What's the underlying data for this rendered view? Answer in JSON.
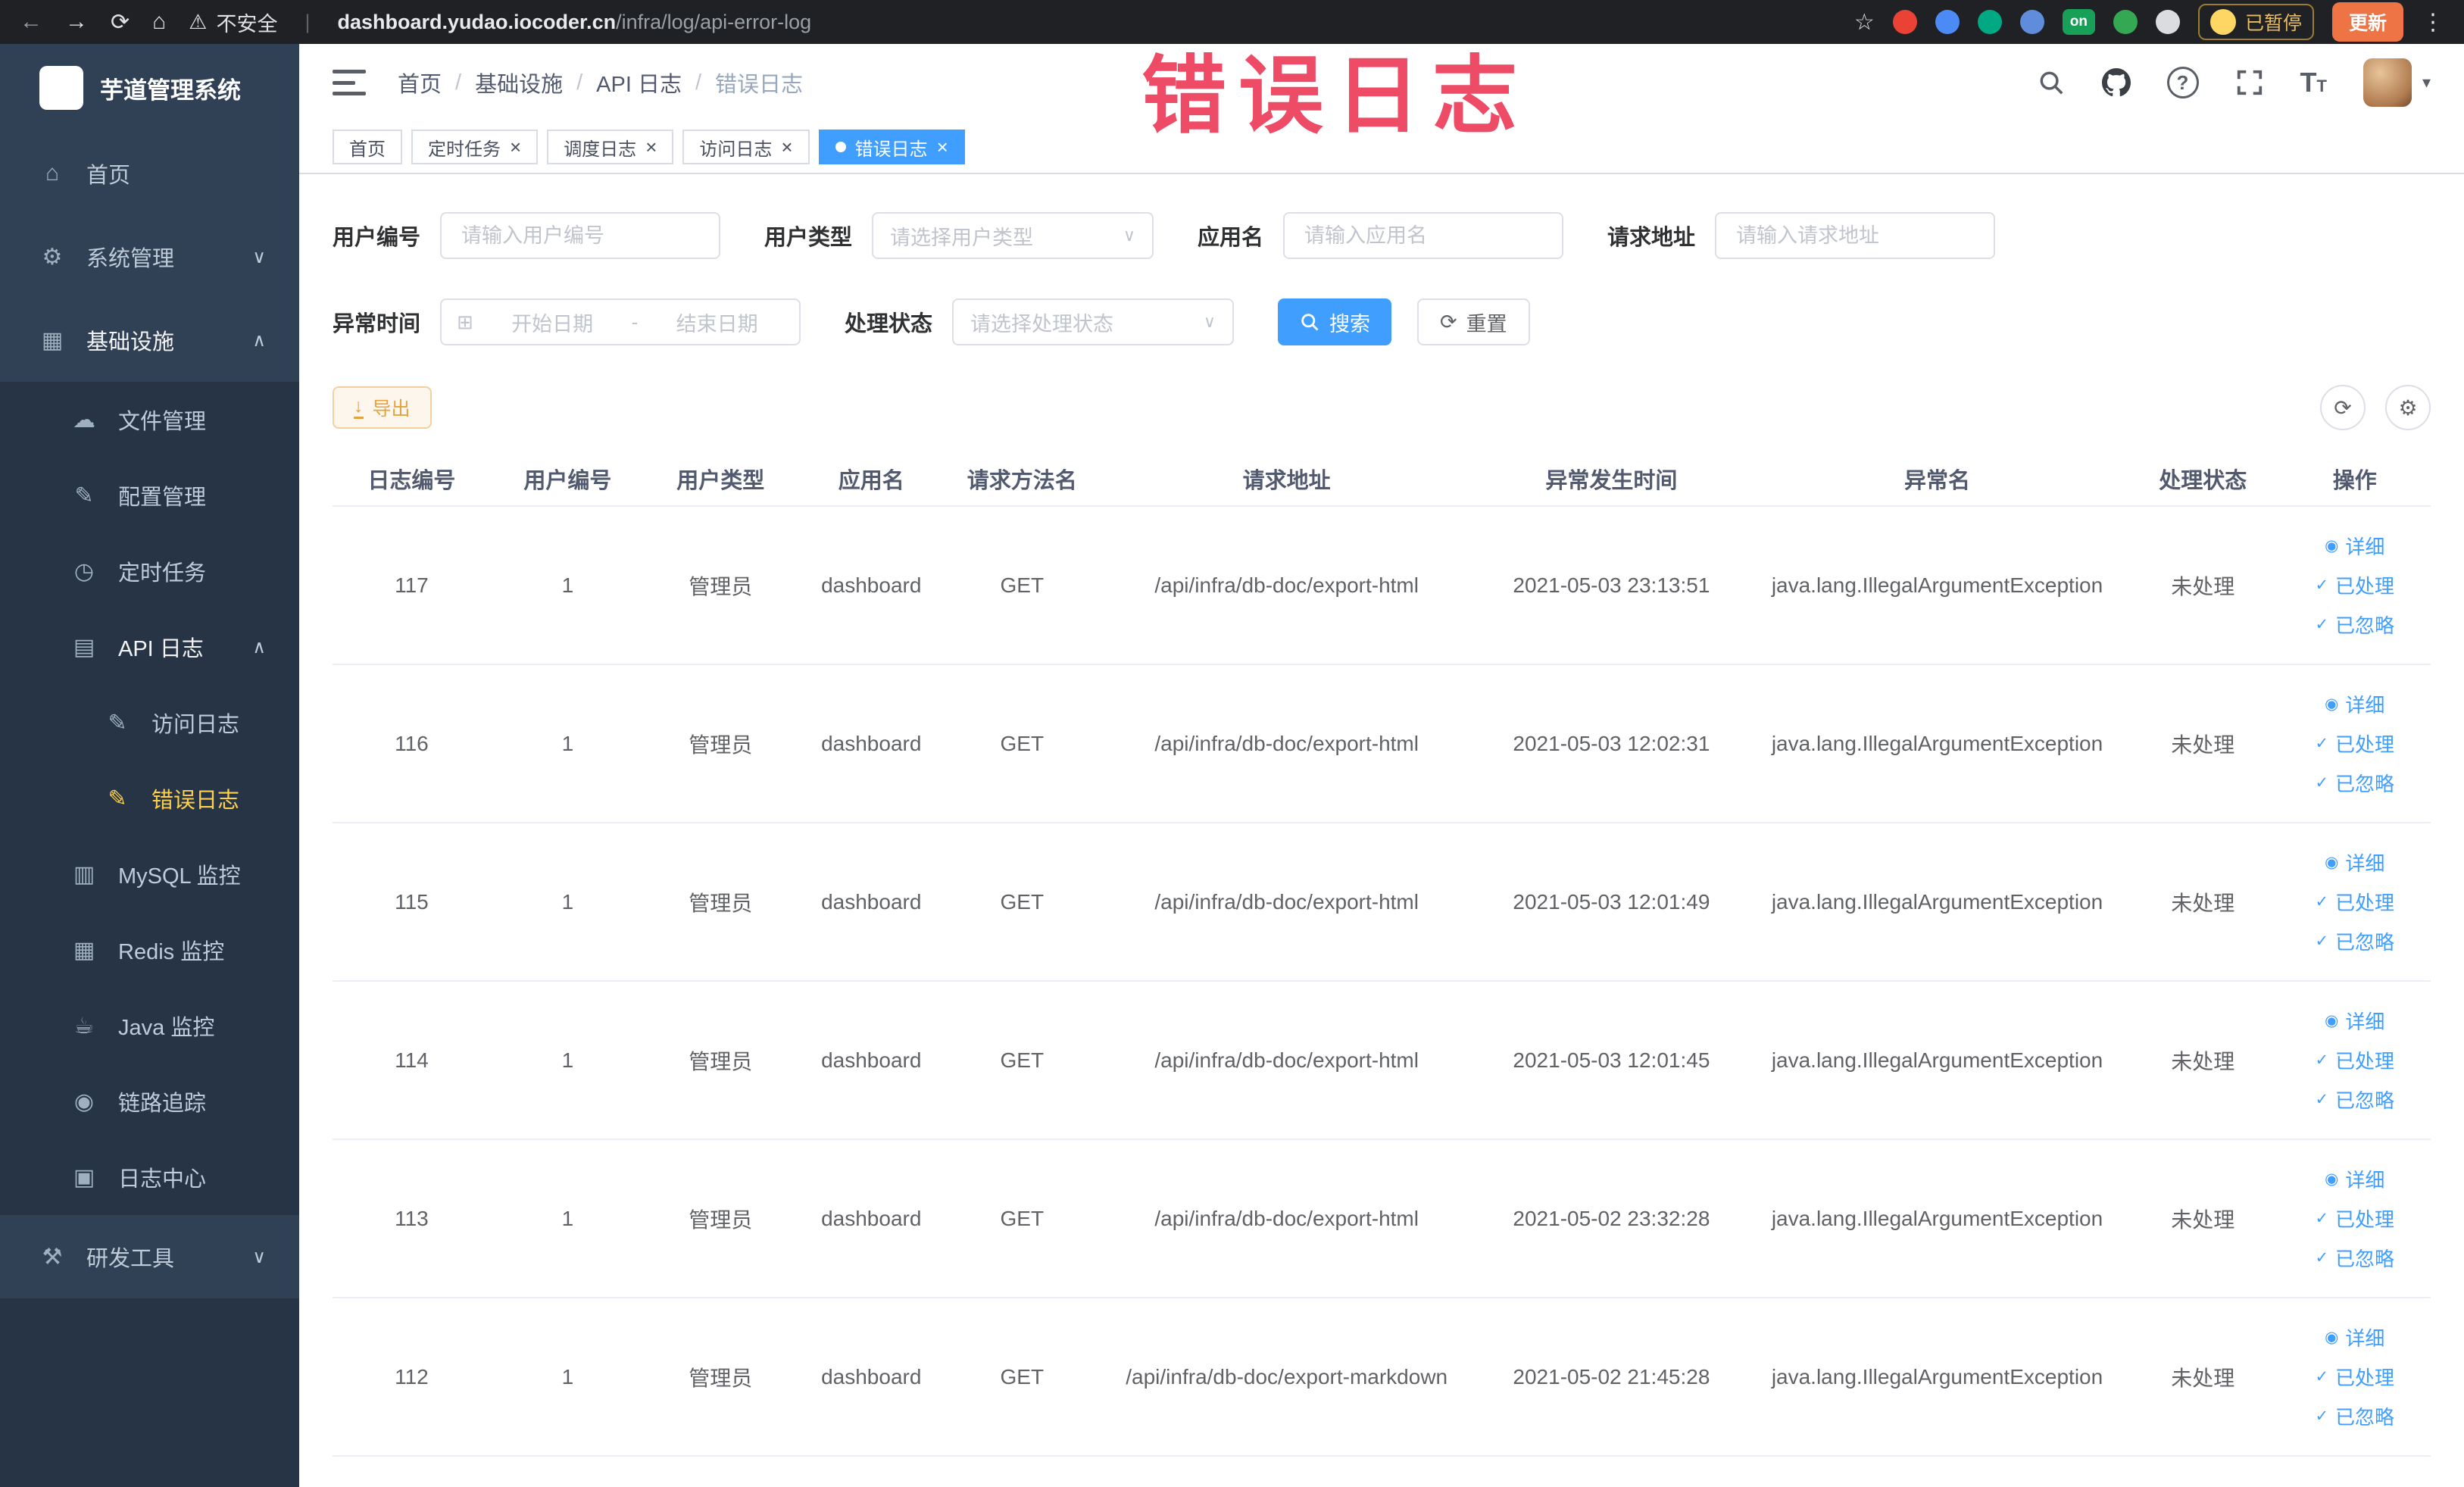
{
  "colors": {
    "accent": "#409eff",
    "sidebar_bg": "#304156",
    "submenu_bg": "#263445",
    "active_menu_text": "#ffd04b",
    "warning": "#e6a23c",
    "overlay_text": "#ee4b66",
    "toolbar_bg": "#202124",
    "update_button_bg": "#ee7445"
  },
  "icons": {
    "back": "←",
    "forward": "→",
    "reload": "⟳",
    "home": "⌂",
    "warning": "⚠",
    "star": "☆",
    "more": "⋮",
    "divider": "|",
    "close": "×",
    "chevron_down": "∨",
    "chevron_up": "∧",
    "caret": "▾",
    "question": "?",
    "letter_t": "T",
    "refresh": "⟳",
    "gear": "⚙",
    "calendar": "⊞",
    "eye": "◉",
    "check": "✓",
    "down_arrow": "↓"
  },
  "browser": {
    "security_label": "不安全",
    "url_host": "dashboard.yudao.iocoder.cn",
    "url_path": "/infra/log/api-error-log",
    "paused_badge": "已暂停",
    "update_button": "更新",
    "extensions": [
      {
        "name": "extension-red-icon",
        "color": "#ea4335"
      },
      {
        "name": "extension-blue-icon",
        "color": "#4c8bf5"
      },
      {
        "name": "extension-teal-icon",
        "color": "#00a884"
      },
      {
        "name": "extension-grid-icon",
        "color": "#5f8ddb"
      },
      {
        "name": "extension-on-badge",
        "color": "#18a058",
        "label": "on",
        "shape": "pill"
      },
      {
        "name": "extension-green-icon",
        "color": "#34a853"
      },
      {
        "name": "extension-paw-icon",
        "color": "#dadce0"
      }
    ]
  },
  "overlay": {
    "text": "错误日志"
  },
  "sidebar": {
    "logo_title": "芋道管理系统",
    "items": [
      {
        "key": "home",
        "label": "首页",
        "icon": "home-icon",
        "glyph": "⌂",
        "level": 1
      },
      {
        "key": "system-mgmt",
        "label": "系统管理",
        "icon": "gear-icon",
        "glyph": "⚙",
        "level": 1,
        "arrow": "down"
      },
      {
        "key": "infrastructure",
        "label": "基础设施",
        "icon": "infrastructure-icon",
        "glyph": "▦",
        "level": 1,
        "arrow": "up"
      },
      {
        "key": "file-mgmt",
        "label": "文件管理",
        "icon": "file-cloud-icon",
        "glyph": "☁",
        "level": 2
      },
      {
        "key": "config-mgmt",
        "label": "配置管理",
        "icon": "config-edit-icon",
        "glyph": "✎",
        "level": 2
      },
      {
        "key": "scheduled-job",
        "label": "定时任务",
        "icon": "clock-icon",
        "glyph": "◷",
        "level": 2
      },
      {
        "key": "api-log",
        "label": "API 日志",
        "icon": "api-log-icon",
        "glyph": "▤",
        "level": 2,
        "arrow": "up"
      },
      {
        "key": "access-log",
        "label": "访问日志",
        "icon": "access-log-icon",
        "glyph": "✎",
        "level": 3
      },
      {
        "key": "error-log",
        "label": "错误日志",
        "icon": "error-log-icon",
        "glyph": "✎",
        "level": 3,
        "active": true
      },
      {
        "key": "mysql-monitor",
        "label": "MySQL 监控",
        "icon": "mysql-icon",
        "glyph": "▥",
        "level": 2
      },
      {
        "key": "redis-monitor",
        "label": "Redis 监控",
        "icon": "redis-icon",
        "glyph": "▦",
        "level": 2
      },
      {
        "key": "java-monitor",
        "label": "Java 监控",
        "icon": "java-icon",
        "glyph": "☕",
        "level": 2
      },
      {
        "key": "link-trace",
        "label": "链路追踪",
        "icon": "trace-eye-icon",
        "glyph": "◉",
        "level": 2
      },
      {
        "key": "log-center",
        "label": "日志中心",
        "icon": "log-center-icon",
        "glyph": "▣",
        "level": 2
      },
      {
        "key": "dev-tools",
        "label": "研发工具",
        "icon": "tools-icon",
        "glyph": "⚒",
        "level": 1,
        "arrow": "down"
      }
    ]
  },
  "breadcrumb": {
    "separator": "/",
    "items": [
      "首页",
      "基础设施",
      "API 日志",
      "错误日志"
    ]
  },
  "tabs": [
    {
      "key": "home",
      "label": "首页",
      "closable": false,
      "active": false
    },
    {
      "key": "scheduled-job",
      "label": "定时任务",
      "closable": true,
      "active": false
    },
    {
      "key": "job-log",
      "label": "调度日志",
      "closable": true,
      "active": false
    },
    {
      "key": "access-log",
      "label": "访问日志",
      "closable": true,
      "active": false
    },
    {
      "key": "error-log",
      "label": "错误日志",
      "closable": true,
      "active": true
    }
  ],
  "filters": {
    "user_id": {
      "label": "用户编号",
      "placeholder": "请输入用户编号",
      "value": ""
    },
    "user_type": {
      "label": "用户类型",
      "placeholder": "请选择用户类型",
      "value": ""
    },
    "app_name": {
      "label": "应用名",
      "placeholder": "请输入应用名",
      "value": ""
    },
    "request_url": {
      "label": "请求地址",
      "placeholder": "请输入请求地址",
      "value": ""
    },
    "exception_time": {
      "label": "异常时间",
      "start_placeholder": "开始日期",
      "separator": "-",
      "end_placeholder": "结束日期"
    },
    "process_status": {
      "label": "处理状态",
      "placeholder": "请选择处理状态",
      "value": ""
    },
    "search_button": "搜索",
    "reset_button": "重置"
  },
  "toolbar": {
    "export_button": "导出"
  },
  "table": {
    "headers": [
      "日志编号",
      "用户编号",
      "用户类型",
      "应用名",
      "请求方法名",
      "请求地址",
      "异常发生时间",
      "异常名",
      "处理状态",
      "操作"
    ],
    "actions": [
      "详细",
      "已处理",
      "已忽略"
    ],
    "rows": [
      {
        "id": "117",
        "user_id": "1",
        "user_type": "管理员",
        "app": "dashboard",
        "method": "GET",
        "url": "/api/infra/db-doc/export-html",
        "time": "2021-05-03 23:13:51",
        "exception": "java.lang.IllegalArgumentException",
        "status": "未处理"
      },
      {
        "id": "116",
        "user_id": "1",
        "user_type": "管理员",
        "app": "dashboard",
        "method": "GET",
        "url": "/api/infra/db-doc/export-html",
        "time": "2021-05-03 12:02:31",
        "exception": "java.lang.IllegalArgumentException",
        "status": "未处理"
      },
      {
        "id": "115",
        "user_id": "1",
        "user_type": "管理员",
        "app": "dashboard",
        "method": "GET",
        "url": "/api/infra/db-doc/export-html",
        "time": "2021-05-03 12:01:49",
        "exception": "java.lang.IllegalArgumentException",
        "status": "未处理"
      },
      {
        "id": "114",
        "user_id": "1",
        "user_type": "管理员",
        "app": "dashboard",
        "method": "GET",
        "url": "/api/infra/db-doc/export-html",
        "time": "2021-05-03 12:01:45",
        "exception": "java.lang.IllegalArgumentException",
        "status": "未处理"
      },
      {
        "id": "113",
        "user_id": "1",
        "user_type": "管理员",
        "app": "dashboard",
        "method": "GET",
        "url": "/api/infra/db-doc/export-html",
        "time": "2021-05-02 23:32:28",
        "exception": "java.lang.IllegalArgumentException",
        "status": "未处理"
      },
      {
        "id": "112",
        "user_id": "1",
        "user_type": "管理员",
        "app": "dashboard",
        "method": "GET",
        "url": "/api/infra/db-doc/export-markdown",
        "time": "2021-05-02 21:45:28",
        "exception": "java.lang.IllegalArgumentException",
        "status": "未处理"
      }
    ]
  }
}
